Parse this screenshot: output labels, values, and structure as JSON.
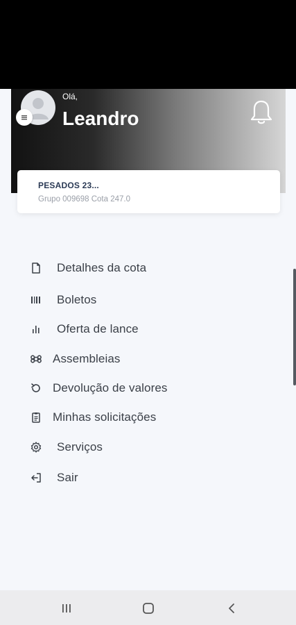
{
  "header": {
    "greeting": "Olá,",
    "user_name": "Leandro"
  },
  "quota_card": {
    "title": "PESADOS 23...",
    "info": "Grupo 009698  Cota 247.0"
  },
  "menu": {
    "items": [
      {
        "label": "Detalhes da cota",
        "icon": "document-icon"
      },
      {
        "label": "Boletos",
        "icon": "barcode-icon"
      },
      {
        "label": "Oferta de lance",
        "icon": "bar-chart-icon"
      },
      {
        "label": "Assembleias",
        "icon": "command-icon"
      },
      {
        "label": "Devolução de valores",
        "icon": "refund-icon"
      },
      {
        "label": "Minhas solicitações",
        "icon": "clipboard-icon"
      },
      {
        "label": "Serviços",
        "icon": "gear-icon"
      },
      {
        "label": "Sair",
        "icon": "logout-icon"
      }
    ]
  },
  "colors": {
    "background": "#f5f7fb",
    "card_title": "#2b3a55",
    "text": "#3b4048"
  }
}
